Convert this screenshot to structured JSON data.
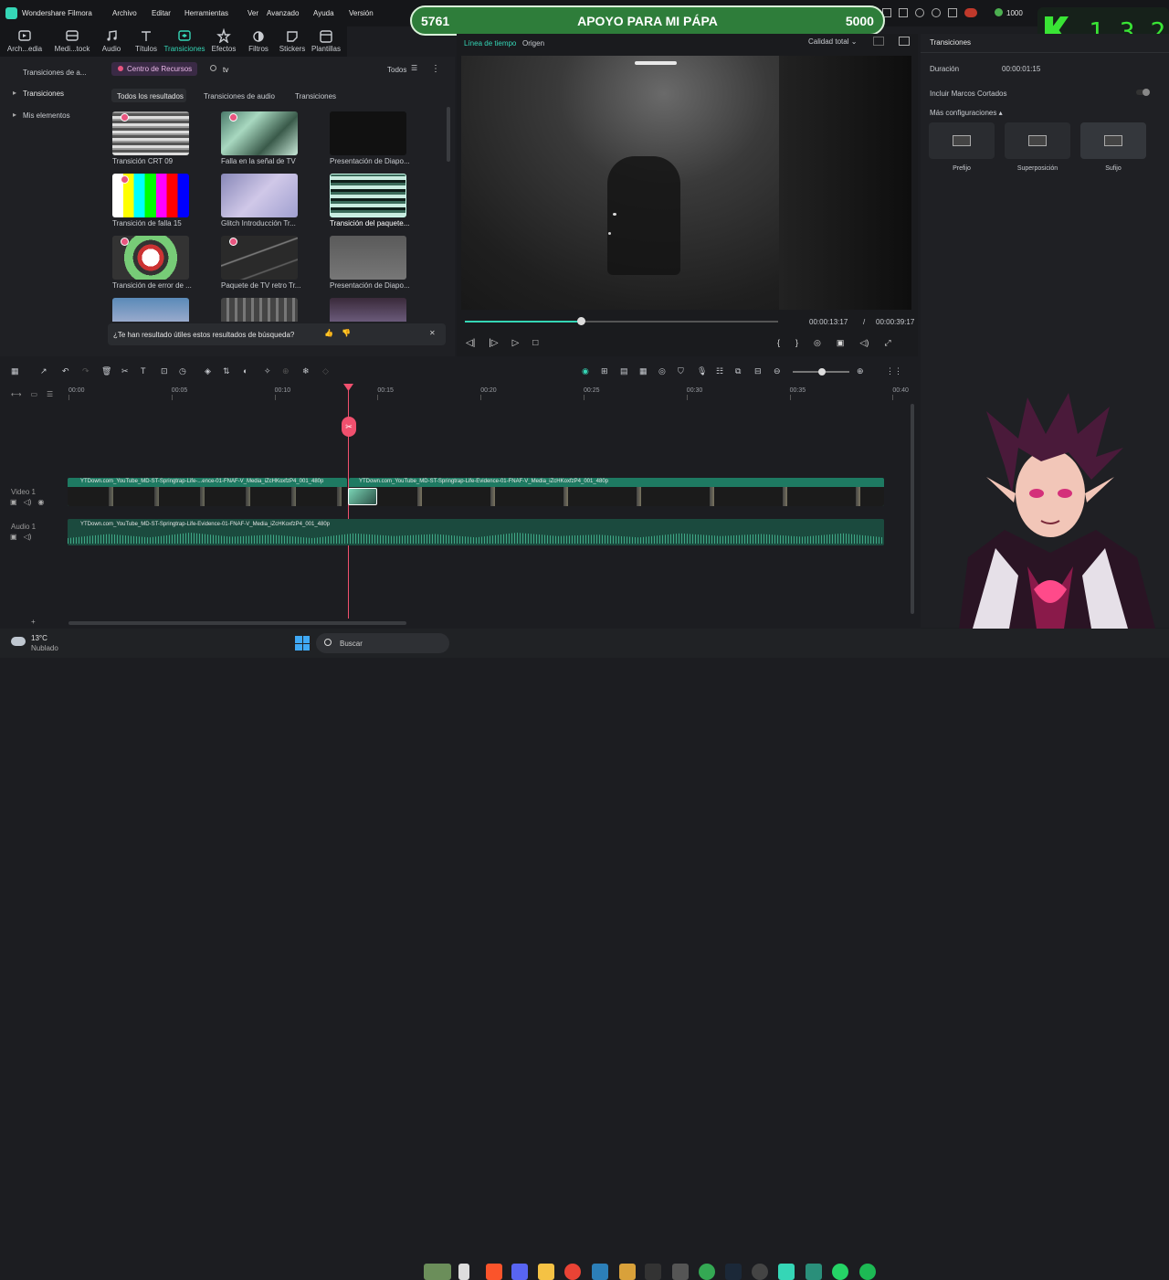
{
  "app": {
    "title": "Wondershare Filmora"
  },
  "menu": [
    "Archivo",
    "Editar",
    "Herramientas",
    "Ver",
    "Avanzado",
    "Ayuda",
    "Versión"
  ],
  "overlay": {
    "left_count": "5761",
    "title": "APOYO PARA MI PÁPA",
    "right_count": "5000",
    "kick_count": "1 3 2",
    "coins": "1000"
  },
  "toolbar": [
    {
      "label": "Arch...edia",
      "icon": "media-icon"
    },
    {
      "label": "Medi...tock",
      "icon": "stock-icon"
    },
    {
      "label": "Audio",
      "icon": "music-icon"
    },
    {
      "label": "Títulos",
      "icon": "title-icon"
    },
    {
      "label": "Transiciones",
      "icon": "transition-icon",
      "active": true
    },
    {
      "label": "Efectos",
      "icon": "effects-icon"
    },
    {
      "label": "Filtros",
      "icon": "filter-icon"
    },
    {
      "label": "Stickers",
      "icon": "sticker-icon"
    },
    {
      "label": "Plantillas",
      "icon": "template-icon"
    }
  ],
  "left_nav": {
    "header": "Transiciones de a...",
    "items": [
      "Transiciones",
      "Mis elementos"
    ]
  },
  "search": {
    "tab": "Centro de Recursos",
    "query": "tv",
    "filter": "Todos"
  },
  "subtabs": [
    "Todos los resultados",
    "Transiciones de audio",
    "Transiciones"
  ],
  "thumbs": [
    {
      "label": "Transición CRT 09",
      "heart": true
    },
    {
      "label": "Falla en la señal de TV",
      "heart": true
    },
    {
      "label": "Presentación de Diapo...",
      "heart": false
    },
    {
      "label": "Transición de falla 15",
      "heart": true
    },
    {
      "label": "Glitch Introducción Tr...",
      "heart": false
    },
    {
      "label": "Transición del paquete...",
      "heart": false
    },
    {
      "label": "Transición de error de ...",
      "heart": true
    },
    {
      "label": "Paquete de TV retro Tr...",
      "heart": true
    },
    {
      "label": "Presentación de Diapo...",
      "heart": false
    }
  ],
  "feedback": "¿Te han resultado útiles estos resultados de búsqueda?",
  "preview": {
    "tabs": [
      "Línea de tiempo",
      "Origen"
    ],
    "quality": "Calidad total",
    "current": "00:00:13:17",
    "separator": "/",
    "total": "00:00:39:17",
    "progress": 0.37
  },
  "props": {
    "title": "Transiciones",
    "duration_label": "Duración",
    "duration": "00:00:01:15",
    "include_label": "Incluir Marcos Cortados",
    "more_label": "Más configuraciones",
    "options": [
      "Prefijo",
      "Superposición",
      "Sufijo"
    ]
  },
  "ruler": [
    "00:00",
    "00:05",
    "00:10",
    "00:15",
    "00:20",
    "00:25",
    "00:30",
    "00:35",
    "00:40"
  ],
  "tracks": {
    "video_label": "Video 1",
    "audio_label": "Audio 1",
    "clip1": "YTDown.com_YouTube_MD-ST-Springtrap-Life-...ence-01-FNAF-V_Media_iZcHKoxfzP4_001_480p",
    "clip2": "YTDown.com_YouTube_MD-ST-Springtrap-Life-Evidence-01-FNAF-V_Media_iZcHKoxfzP4_001_480p",
    "audio_clip": "YTDown.com_YouTube_MD-ST-Springtrap-Life-Evidence-01-FNAF-V_Media_iZcHKoxfzP4_001_480p"
  },
  "taskbar": {
    "temp": "13°C",
    "weather": "Nublado",
    "search": "Buscar"
  },
  "colors": {
    "accent": "#35d6b6",
    "playhead": "#f0506e",
    "overlay_green": "#2e7d3a",
    "clip_green": "#1e7a62"
  }
}
